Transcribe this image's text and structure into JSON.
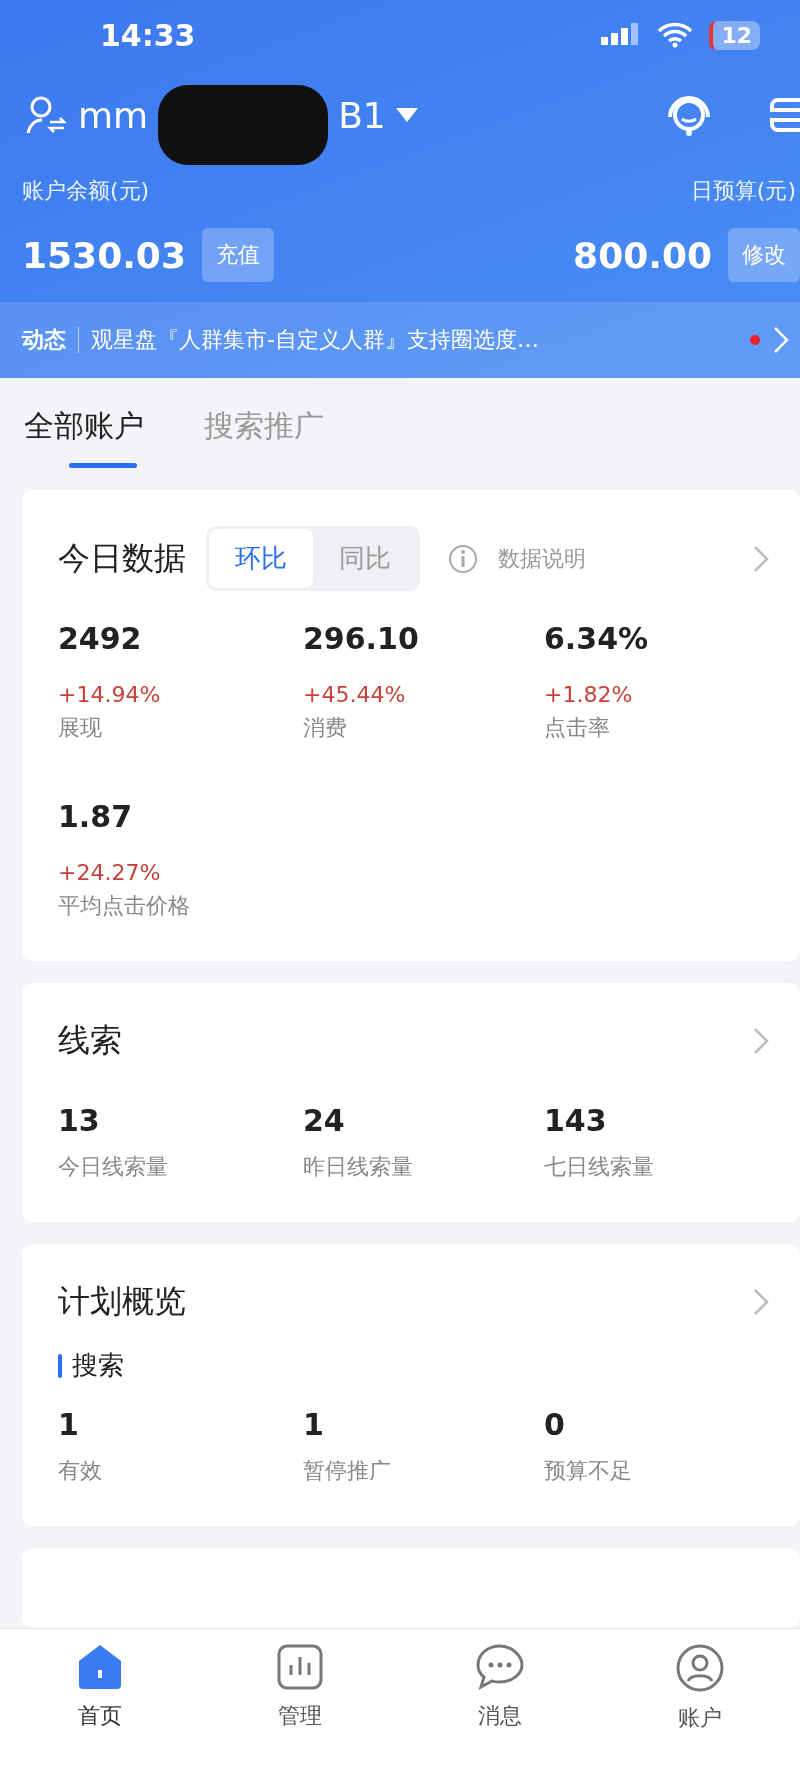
{
  "status_bar": {
    "time": "14:33",
    "battery": "12"
  },
  "account": {
    "name_start": "mm",
    "name_end": "B1"
  },
  "balance": {
    "label": "账户余额(元)",
    "value": "1530.03",
    "button": "充值"
  },
  "budget": {
    "label": "日预算(元)",
    "value": "800.00",
    "button": "修改"
  },
  "news": {
    "label": "动态",
    "text": "观星盘『人群集市-自定义人群』支持圈选度…",
    "unread": true
  },
  "tabs": [
    {
      "label": "全部账户",
      "selected": true
    },
    {
      "label": "搜索推广",
      "selected": false
    }
  ],
  "today": {
    "title": "今日数据",
    "segments": [
      {
        "label": "环比",
        "selected": true
      },
      {
        "label": "同比",
        "selected": false
      }
    ],
    "help": "数据说明",
    "metrics": [
      {
        "value": "2492",
        "change": "+14.94%",
        "label": "展现"
      },
      {
        "value": "296.10",
        "change": "+45.44%",
        "label": "消费"
      },
      {
        "value": "6.34%",
        "change": "+1.82%",
        "label": "点击率"
      },
      {
        "value": "1.87",
        "change": "+24.27%",
        "label": "平均点击价格"
      }
    ]
  },
  "leads": {
    "title": "线索",
    "metrics": [
      {
        "value": "13",
        "label": "今日线索量"
      },
      {
        "value": "24",
        "label": "昨日线索量"
      },
      {
        "value": "143",
        "label": "七日线索量"
      }
    ]
  },
  "plans": {
    "title": "计划概览",
    "section": "搜索",
    "metrics": [
      {
        "value": "1",
        "label": "有效"
      },
      {
        "value": "1",
        "label": "暂停推广"
      },
      {
        "value": "0",
        "label": "预算不足"
      }
    ]
  },
  "nav": [
    {
      "label": "首页",
      "kind": "home",
      "selected": true
    },
    {
      "label": "管理",
      "kind": "chart",
      "selected": false
    },
    {
      "label": "消息",
      "kind": "message",
      "selected": false
    },
    {
      "label": "账户",
      "kind": "user",
      "selected": false
    }
  ]
}
